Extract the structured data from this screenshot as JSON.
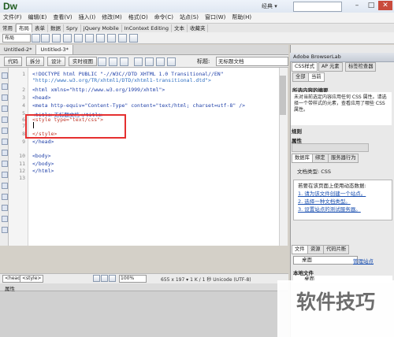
{
  "app": {
    "logo": "Dw",
    "workspace": "经典 ▾"
  },
  "window_buttons": [
    "–",
    "□",
    "✕"
  ],
  "menubar": [
    "文件(F)",
    "编辑(E)",
    "查看(V)",
    "插入(I)",
    "修改(M)",
    "格式(O)",
    "命令(C)",
    "站点(S)",
    "窗口(W)",
    "帮助(H)"
  ],
  "insert_tabs": [
    "常用",
    "布局",
    "表单",
    "数据",
    "Spry",
    "jQuery Mobile",
    "InContext Editing",
    "文本",
    "收藏夹"
  ],
  "insert_dropdown": "布局",
  "doc_tabs": [
    "Untitled-2*",
    "Untitled-3*"
  ],
  "doc_path": "",
  "view_buttons": [
    "代码",
    "拆分",
    "设计",
    "实时视图"
  ],
  "title_label": "标题:",
  "title_value": "无标题文档",
  "code": {
    "line_numbers": [
      "1",
      "2",
      "3",
      "4",
      "5",
      "6",
      "7",
      "8",
      "9",
      "10",
      "11",
      "12",
      "13"
    ],
    "lines": [
      "<!DOCTYPE html PUBLIC \"-//W3C//DTD XHTML 1.0 Transitional//EN\"",
      "\"http://www.w3.org/TR/xhtml1/DTD/xhtml1-transitional.dtd\">",
      "<html xmlns=\"http://www.w3.org/1999/xhtml\">",
      "<head>",
      "<meta http-equiv=\"Content-Type\" content=\"text/html; charset=utf-8\" />",
      "<title>无标题文档</title>",
      "<style type=\"text/css\">",
      "",
      "</style>",
      "</head>",
      "",
      "<body>",
      "</body>",
      "</html>"
    ]
  },
  "status": {
    "tags": [
      "<head>",
      "<style>"
    ],
    "zoom": "100%",
    "dims": "655 x 197 ▾ 1 K / 1 秒 Unicode (UTF-8)"
  },
  "properties_label": "属性",
  "panels": {
    "browserlab": "Adobe BrowserLab",
    "css_tabs": [
      "CSS样式",
      "AP 元素",
      "标签检查器"
    ],
    "css_subtabs": [
      "全部",
      "当前"
    ],
    "css_title": "所选内容的摘要",
    "css_msg": "未对当前选定内容应用任何 CSS 属性。请选择一个带样式的元素，查看应用了哪些 CSS 属性。",
    "rules_label": "规则",
    "attrs_label": "属性",
    "db_tabs": [
      "数据库",
      "绑定",
      "服务器行为"
    ],
    "doc_type": "文档类型: CSS",
    "db_intro": "若要在该页面上使用动态数据:",
    "db_steps": [
      "1. 请为该文件创建一个站点。",
      "2. 选择一种文档类型。",
      "3. 设置站点的测试服务器。"
    ],
    "file_tabs": [
      "文件",
      "资源",
      "代码片断"
    ],
    "site_select": "桌面",
    "manage_sites": "管理站点",
    "local_title": "本地文件",
    "local_item": "桌面"
  },
  "watermark": "软件技巧"
}
